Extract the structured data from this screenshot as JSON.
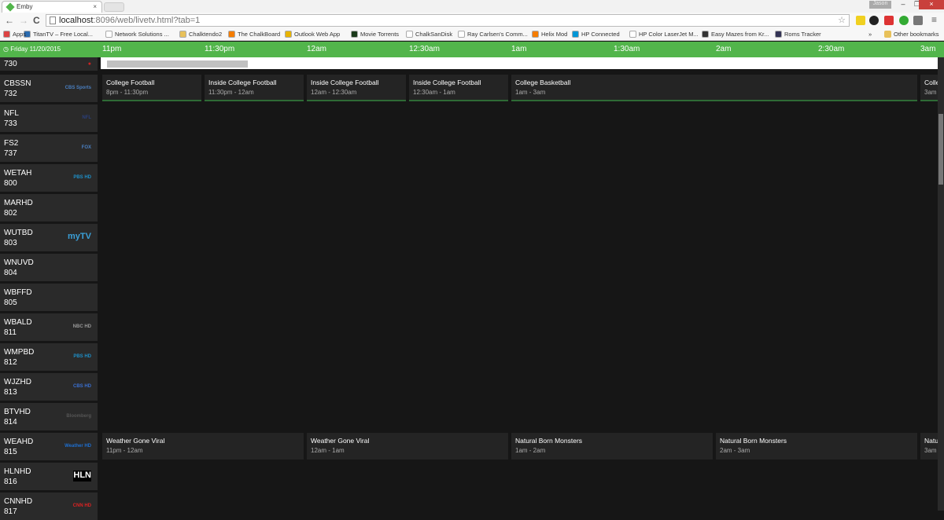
{
  "browser": {
    "tab_title": "Emby",
    "tab_close": "×",
    "user": "Jason",
    "url_host": "localhost",
    "url_path": ":8096/web/livetv.html?tab=1",
    "back": "←",
    "forward": "→",
    "reload": "C",
    "star": "☆",
    "menu": "≡",
    "min": "–",
    "max": "❐",
    "close": "×",
    "bookmarks": [
      {
        "label": "Apps",
        "color": "#d44"
      },
      {
        "label": "TitanTV – Free Local...",
        "color": "#2a6bb0"
      },
      {
        "label": "Network Solutions ...",
        "color": "#fff"
      },
      {
        "label": "Chalktendo2",
        "color": "#e8c15a"
      },
      {
        "label": "The ChalkBoard",
        "color": "#f57d00"
      },
      {
        "label": "Outlook Web App",
        "color": "#e8b400"
      },
      {
        "label": "Movie Torrents",
        "color": "#1a3a1a"
      },
      {
        "label": "ChalkSanDisk",
        "color": "#fff"
      },
      {
        "label": "Ray Carlsen's Comm...",
        "color": "#fff"
      },
      {
        "label": "Helix Mod",
        "color": "#f57d00"
      },
      {
        "label": "HP Connected",
        "color": "#0096d6"
      },
      {
        "label": "HP Color LaserJet M...",
        "color": "#fff"
      },
      {
        "label": "Easy Mazes from Kr...",
        "color": "#333"
      },
      {
        "label": "Roms Tracker",
        "color": "#335"
      }
    ],
    "overflow": "»",
    "other_bookmarks": "Other bookmarks"
  },
  "guide": {
    "date": "Friday 11/20/2015",
    "times": [
      "11pm",
      "11:30pm",
      "12am",
      "12:30am",
      "1am",
      "1:30am",
      "2am",
      "2:30am",
      "3am"
    ],
    "partial_channel_number": "730",
    "channels": [
      {
        "name": "CBSSN",
        "number": "732",
        "logo": "CBS Sports",
        "logo_color": "#4a7fc0",
        "programs": [
          {
            "title": "College Football",
            "time": "8pm - 11:30pm",
            "start": 0,
            "end": 1,
            "sports": true
          },
          {
            "title": "Inside College Football",
            "time": "11:30pm - 12am",
            "start": 1,
            "end": 2,
            "sports": true
          },
          {
            "title": "Inside College Football",
            "time": "12am - 12:30am",
            "start": 2,
            "end": 3,
            "sports": true
          },
          {
            "title": "Inside College Football",
            "time": "12:30am - 1am",
            "start": 3,
            "end": 4,
            "sports": true
          },
          {
            "title": "College Basketball",
            "time": "1am - 3am",
            "start": 4,
            "end": 8,
            "sports": true
          },
          {
            "title": "College Basketball",
            "time": "3am",
            "start": 8,
            "end": 10,
            "sports": true
          }
        ]
      },
      {
        "name": "NFL",
        "number": "733",
        "logo": "NFL",
        "logo_color": "#2a3f7a",
        "programs": []
      },
      {
        "name": "FS2",
        "number": "737",
        "logo": "FOX",
        "logo_color": "#4a7fc0",
        "programs": []
      },
      {
        "name": "WETAH",
        "number": "800",
        "logo": "PBS HD",
        "logo_color": "#1e8fc7",
        "programs": []
      },
      {
        "name": "MARHD",
        "number": "802",
        "logo": "",
        "logo_color": "#fff",
        "programs": []
      },
      {
        "name": "WUTBD",
        "number": "803",
        "logo": "myTV",
        "logo_color": "#3aa0d8",
        "programs": []
      },
      {
        "name": "WNUVD",
        "number": "804",
        "logo": "",
        "logo_color": "#fff",
        "programs": []
      },
      {
        "name": "WBFFD",
        "number": "805",
        "logo": "",
        "logo_color": "#fff",
        "programs": []
      },
      {
        "name": "WBALD",
        "number": "811",
        "logo": "NBC HD",
        "logo_color": "#999",
        "programs": []
      },
      {
        "name": "WMPBD",
        "number": "812",
        "logo": "PBS HD",
        "logo_color": "#1e8fc7",
        "programs": []
      },
      {
        "name": "WJZHD",
        "number": "813",
        "logo": "CBS HD",
        "logo_color": "#3a6fd0",
        "programs": []
      },
      {
        "name": "BTVHD",
        "number": "814",
        "logo": "Bloomberg",
        "logo_color": "#555",
        "programs": []
      },
      {
        "name": "WEAHD",
        "number": "815",
        "logo": "Weather HD",
        "logo_color": "#1e6fd0",
        "programs": [
          {
            "title": "Weather Gone Viral",
            "time": "11pm - 12am",
            "start": 0,
            "end": 2,
            "sports": false
          },
          {
            "title": "Weather Gone Viral",
            "time": "12am - 1am",
            "start": 2,
            "end": 4,
            "sports": false
          },
          {
            "title": "Natural Born Monsters",
            "time": "1am - 2am",
            "start": 4,
            "end": 6,
            "sports": false
          },
          {
            "title": "Natural Born Monsters",
            "time": "2am - 3am",
            "start": 6,
            "end": 8,
            "sports": false
          },
          {
            "title": "Natural Born Monsters",
            "time": "3am",
            "start": 8,
            "end": 10,
            "sports": false
          }
        ]
      },
      {
        "name": "HLNHD",
        "number": "816",
        "logo": "HLN",
        "logo_color": "#fff",
        "programs": []
      },
      {
        "name": "CNNHD",
        "number": "817",
        "logo": "CNN HD",
        "logo_color": "#d22",
        "programs": []
      }
    ]
  }
}
